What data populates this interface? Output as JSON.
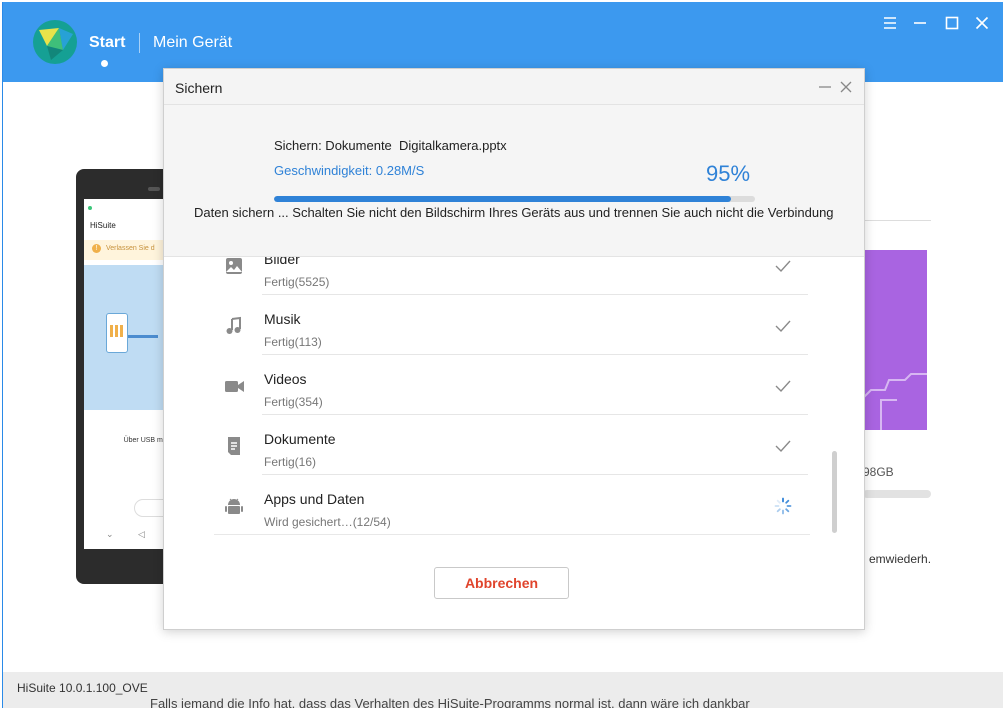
{
  "app": {
    "nav_start": "Start",
    "nav_device": "Mein Gerät",
    "version": "HiSuite 10.0.1.100_OVE",
    "colors": {
      "accent": "#3c99ef",
      "brand_logo": "#15a094",
      "progress": "#2f82d7",
      "cancel_text": "#e0442c"
    }
  },
  "background": {
    "phone_app_name": "HiSuite",
    "phone_warning": "Verlassen Sie d",
    "phone_usb": "Über USB mit",
    "storage_fragment": "98GB",
    "restore_fragment": "emwiederh.",
    "bottom_overflow": "Falls jemand die Info hat, dass das Verhalten des HiSuite-Programms normal ist, dann wäre ich dankbar"
  },
  "dialog": {
    "title": "Sichern",
    "current_file": "Sichern: Dokumente  Digitalkamera.pptx",
    "speed": "Geschwindigkeit: 0.28M/S",
    "percent_label": "95%",
    "progress_fraction": 0.95,
    "warning": "Daten sichern ... Schalten Sie nicht den Bildschirm Ihres Geräts aus und trennen Sie auch nicht die Verbindung.",
    "cancel_label": "Abbrechen",
    "items": [
      {
        "name": "Bilder",
        "status": "Fertig(5525)",
        "icon": "image-icon",
        "done": true
      },
      {
        "name": "Musik",
        "status": "Fertig(113)",
        "icon": "music-icon",
        "done": true
      },
      {
        "name": "Videos",
        "status": "Fertig(354)",
        "icon": "video-icon",
        "done": true
      },
      {
        "name": "Dokumente",
        "status": "Fertig(16)",
        "icon": "document-icon",
        "done": true
      },
      {
        "name": "Apps und Daten",
        "status": "Wird gesichert…(12/54)",
        "icon": "android-icon",
        "done": false
      }
    ]
  }
}
